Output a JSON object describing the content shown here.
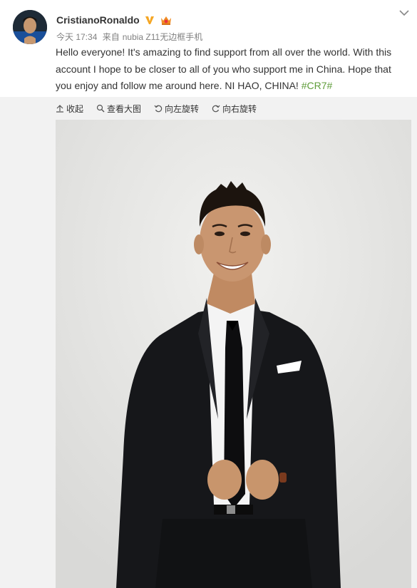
{
  "user": {
    "name": "CristianoRonaldo",
    "verified_icon": "verified-v-icon",
    "member_icon": "crown-icon"
  },
  "meta": {
    "time": "今天 17:34",
    "source_prefix": "来自",
    "source": "nubia Z11无边框手机"
  },
  "post": {
    "text": "Hello everyone! It's amazing to find support from all over the world. With this account I hope to be closer to all of you who support me in China. Hope that you enjoy and follow me around here. NI HAO, CHINA! ",
    "hashtag": "#CR7#"
  },
  "toolbar": {
    "collapse": "收起",
    "view_large": "查看大图",
    "rotate_left": "向左旋转",
    "rotate_right": "向右旋转"
  },
  "colors": {
    "hashtag": "#5f9d3a",
    "verified": "#f5a623",
    "meta": "#808080"
  }
}
